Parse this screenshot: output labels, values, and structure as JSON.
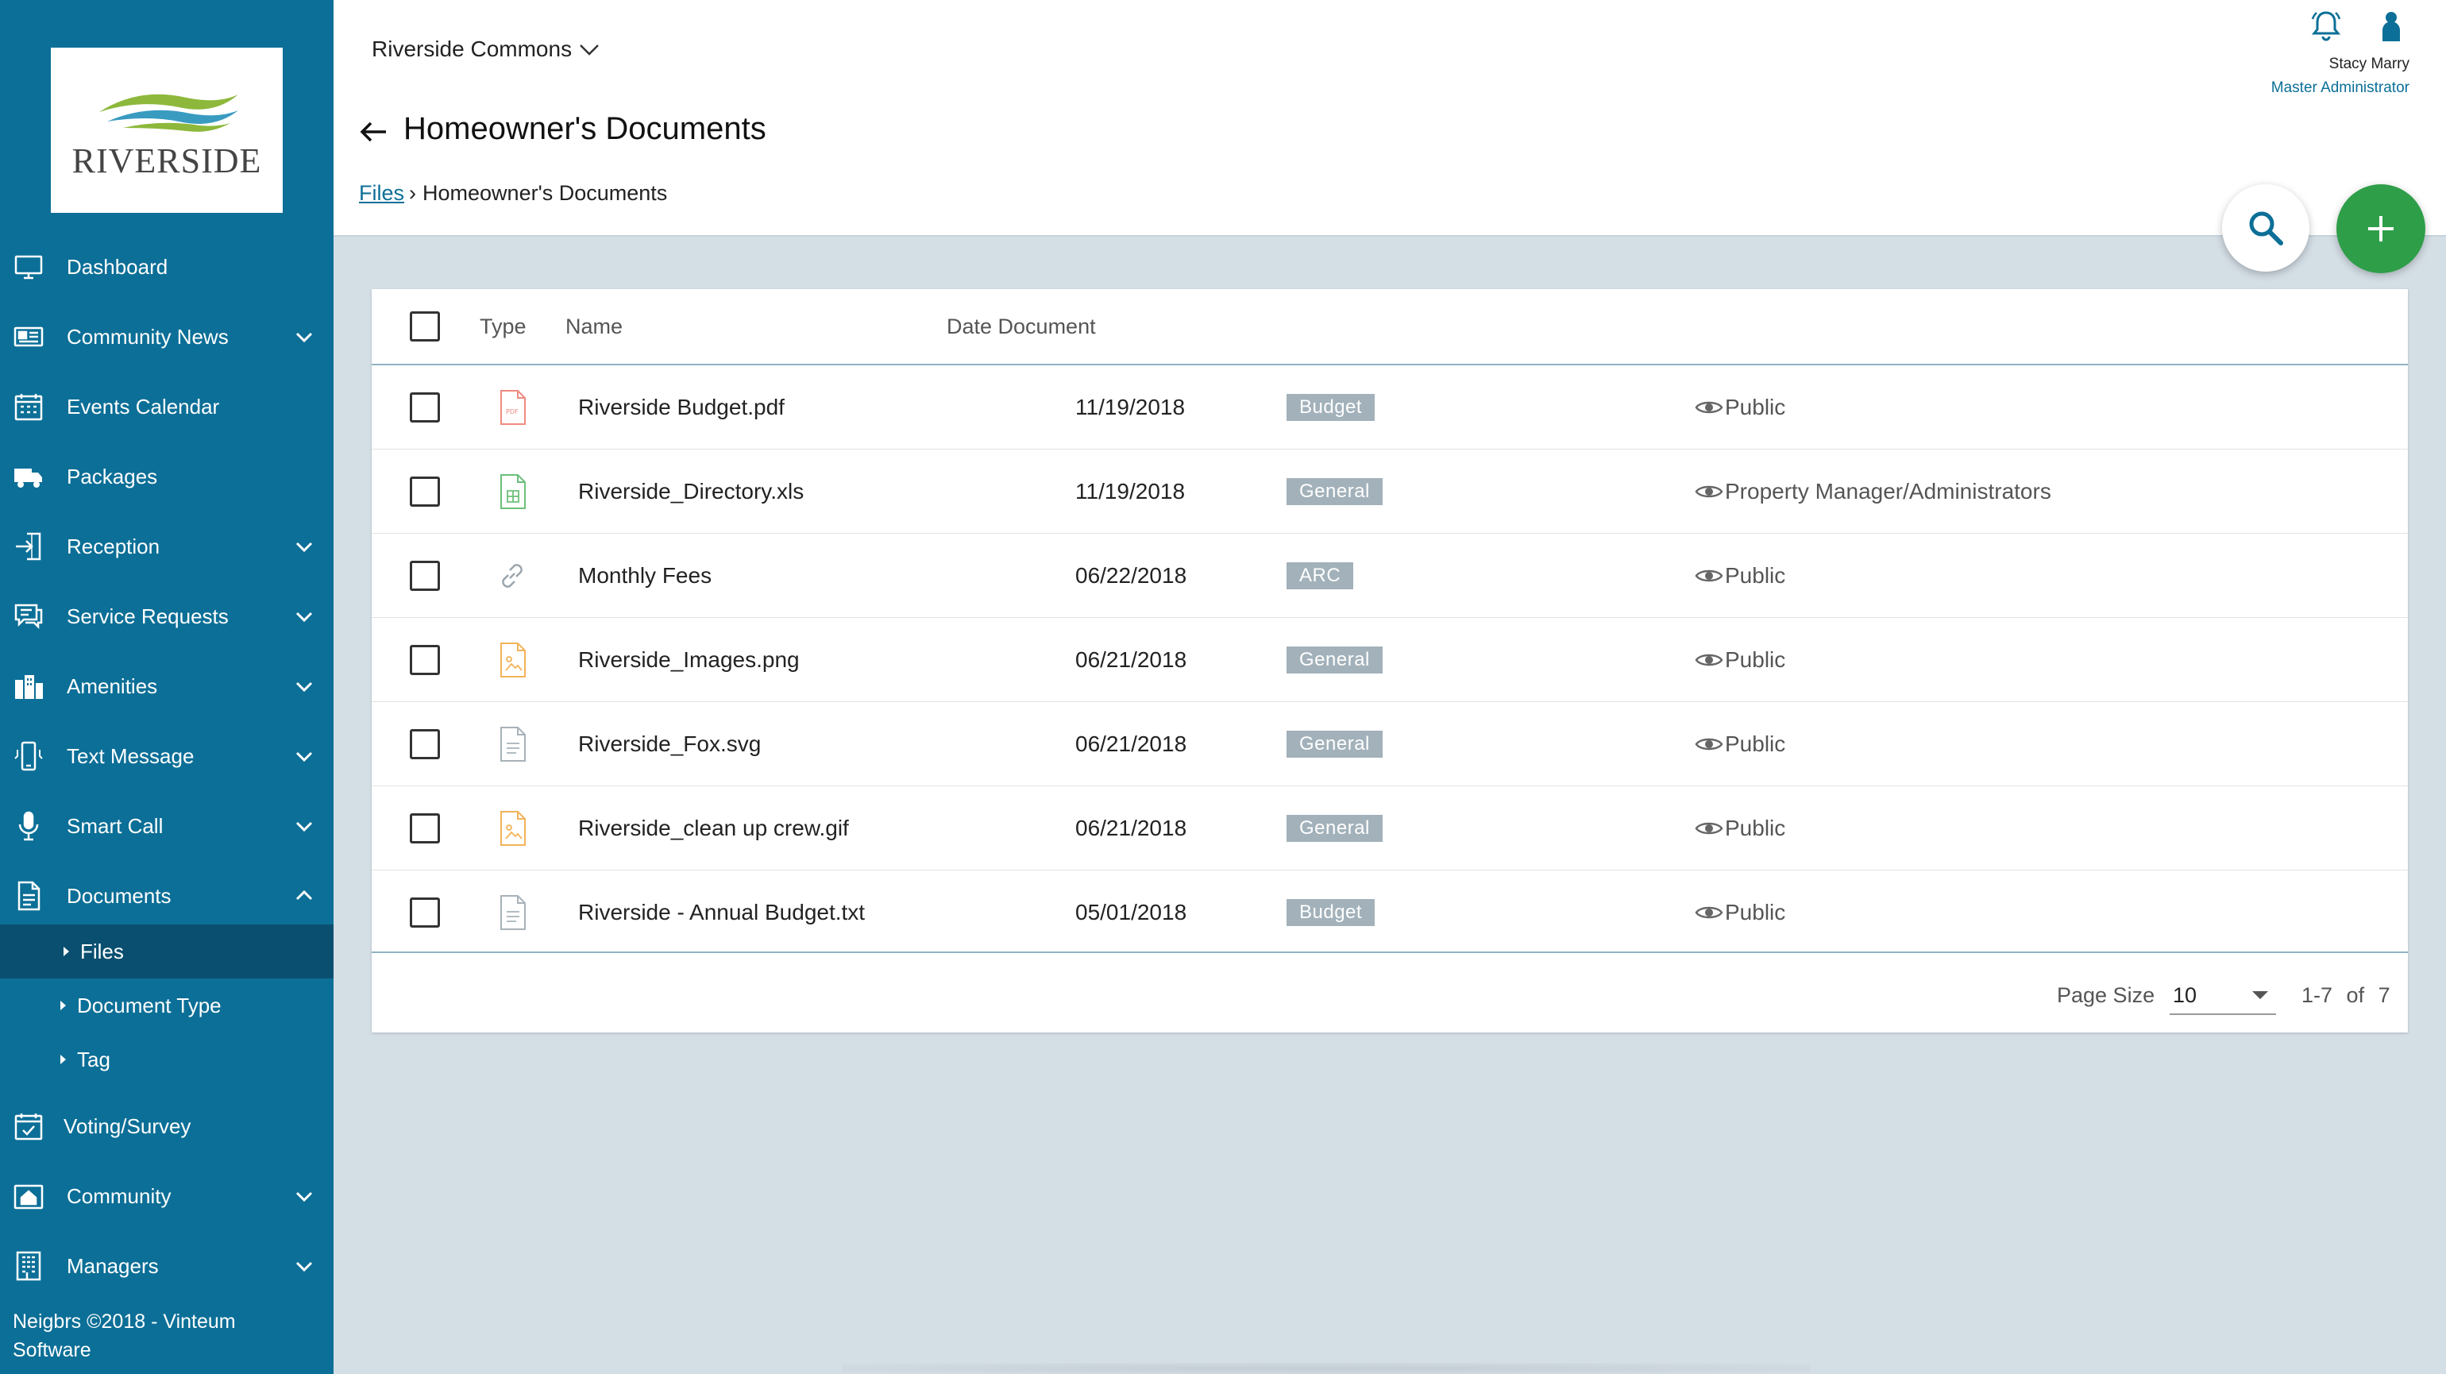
{
  "brand": {
    "logo_text": "RIVERSIDE"
  },
  "sidebar": {
    "items": [
      {
        "label": "Dashboard",
        "icon": "monitor-icon",
        "has_chevron": false
      },
      {
        "label": "Community News",
        "icon": "newspaper-icon",
        "has_chevron": true
      },
      {
        "label": "Events Calendar",
        "icon": "calendar-icon",
        "has_chevron": false
      },
      {
        "label": "Packages",
        "icon": "truck-icon",
        "has_chevron": false
      },
      {
        "label": "Reception",
        "icon": "door-enter-icon",
        "has_chevron": true
      },
      {
        "label": "Service Requests",
        "icon": "chat-icon",
        "has_chevron": true
      },
      {
        "label": "Amenities",
        "icon": "building-icon",
        "has_chevron": true
      },
      {
        "label": "Text Message",
        "icon": "phone-message-icon",
        "has_chevron": true
      },
      {
        "label": "Smart Call",
        "icon": "microphone-icon",
        "has_chevron": true
      },
      {
        "label": "Documents",
        "icon": "document-icon",
        "has_chevron": true,
        "expanded": true
      }
    ],
    "documents_subitems": [
      {
        "label": "Files",
        "active": true
      },
      {
        "label": "Document Type",
        "active": false
      },
      {
        "label": "Tag",
        "active": false
      }
    ],
    "bottom_items": [
      {
        "label": "Voting/Survey",
        "icon": "calendar-check-icon",
        "has_chevron": false
      },
      {
        "label": "Community",
        "icon": "home-icon",
        "has_chevron": true
      },
      {
        "label": "Managers",
        "icon": "office-building-icon",
        "has_chevron": true
      }
    ],
    "footer": "Neigbrs ©2018 - Vinteum Software"
  },
  "header": {
    "community": "Riverside Commons",
    "title": "Homeowner's Documents",
    "breadcrumb": {
      "link": "Files",
      "current": "Homeowner's Documents"
    },
    "user": {
      "name": "Stacy Marry",
      "role": "Master Administrator"
    }
  },
  "table": {
    "columns": {
      "type": "Type",
      "name": "Name",
      "date": "Date Document"
    },
    "rows": [
      {
        "type": "pdf",
        "name": "Riverside Budget.pdf",
        "date": "11/19/2018",
        "tag": "Budget",
        "visibility": "Public"
      },
      {
        "type": "xls",
        "name": "Riverside_Directory.xls",
        "date": "11/19/2018",
        "tag": "General",
        "visibility": "Property Manager/Administrators"
      },
      {
        "type": "link",
        "name": "Monthly Fees",
        "date": "06/22/2018",
        "tag": "ARC",
        "visibility": "Public"
      },
      {
        "type": "image",
        "name": "Riverside_Images.png",
        "date": "06/21/2018",
        "tag": "General",
        "visibility": "Public"
      },
      {
        "type": "text",
        "name": "Riverside_Fox.svg",
        "date": "06/21/2018",
        "tag": "General",
        "visibility": "Public"
      },
      {
        "type": "image",
        "name": "Riverside_clean up crew.gif",
        "date": "06/21/2018",
        "tag": "General",
        "visibility": "Public"
      },
      {
        "type": "text",
        "name": "Riverside - Annual Budget.txt",
        "date": "05/01/2018",
        "tag": "Budget",
        "visibility": "Public"
      }
    ]
  },
  "pagination": {
    "page_size_label": "Page Size",
    "page_size": "10",
    "range": "1-7",
    "of_label": "of",
    "total": "7"
  },
  "colors": {
    "sidebar": "#0c6f97",
    "active_sub": "#0a4f70",
    "add_button": "#2e9e49",
    "tag_bg": "#a2b1ba",
    "background": "#d4dee5"
  }
}
